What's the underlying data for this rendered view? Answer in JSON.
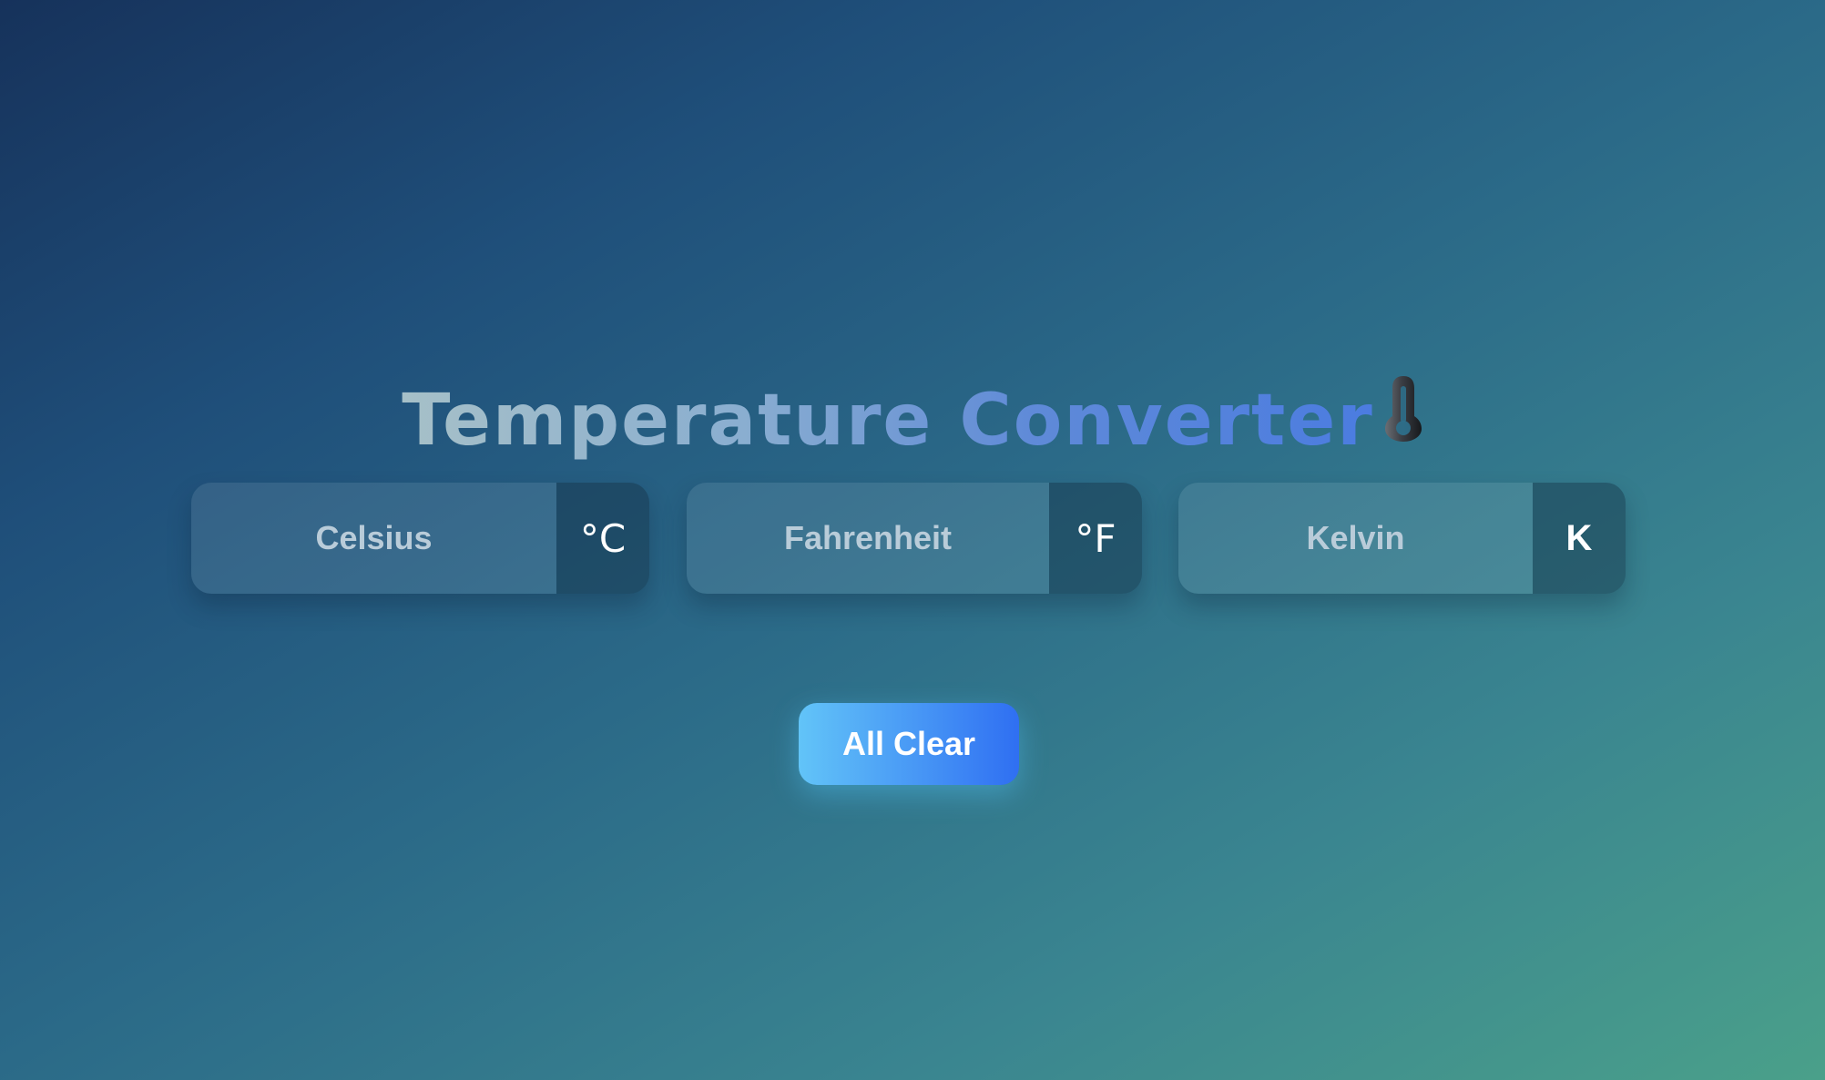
{
  "header": {
    "title_word_1": "Temperature",
    "title_word_2": "Converter",
    "title_icon": "thermometer-icon"
  },
  "fields": [
    {
      "label": "Celsius",
      "unit": "°C"
    },
    {
      "label": "Fahrenheit",
      "unit": "°F"
    },
    {
      "label": "Kelvin",
      "unit": "K"
    }
  ],
  "actions": {
    "clear_label": "All Clear"
  },
  "colors": {
    "background_start": "#16325b",
    "background_end": "#4aa08a",
    "button_gradient_start": "#62c4f8",
    "button_gradient_end": "#2f6ff2",
    "field_label_text": "#b9ccd9"
  }
}
